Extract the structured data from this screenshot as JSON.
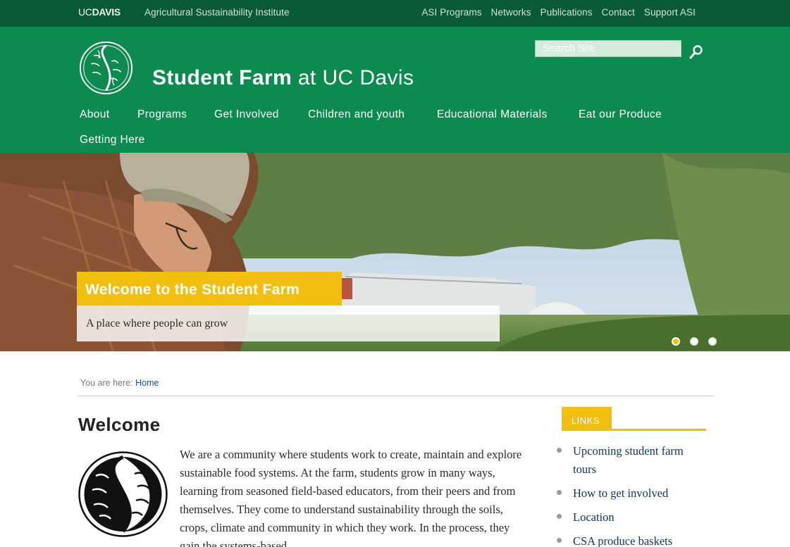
{
  "topbar": {
    "logo": {
      "uc": "UC",
      "davis": "DAVIS"
    },
    "institute": "Agricultural Sustainability Institute",
    "links": [
      "ASI Programs",
      "Networks",
      "Publications",
      "Contact",
      "Support ASI"
    ]
  },
  "header": {
    "title_strong": "Student Farm",
    "title_light": "at UC Davis",
    "search_placeholder": "Search Site",
    "search_icon": "search-icon"
  },
  "nav": {
    "items": [
      "About",
      "Programs",
      "Get Involved",
      "Children and youth",
      "Educational Materials",
      "Eat our Produce",
      "Getting Here"
    ]
  },
  "hero": {
    "title": "Welcome to the Student Farm",
    "subtitle": "A place where people can grow",
    "slide_count": 3,
    "active_slide": 1
  },
  "breadcrumb": {
    "prefix": "You are here:",
    "home": "Home"
  },
  "main": {
    "title": "Welcome",
    "intro": "We are a community where students work to create, maintain and explore sustainable food systems. At the farm, students grow in many ways, learning from seasoned field-based educators, from their peers and from themselves. They come to understand sustainability through the soils, crops, climate and community in which they work. In the process, they gain the systems-based"
  },
  "sidebar": {
    "heading": "LINKS",
    "links": [
      "Upcoming student farm tours",
      "How to get involved",
      "Location",
      "CSA produce baskets"
    ]
  },
  "colors": {
    "topbar": "#0a5a37",
    "header": "#0c8a4f",
    "accent": "#f2bf10",
    "link": "#0a58a8"
  }
}
